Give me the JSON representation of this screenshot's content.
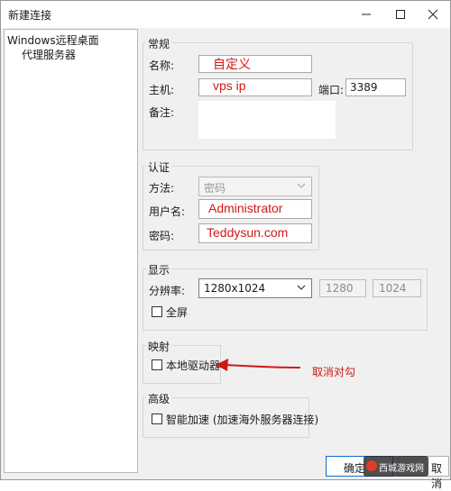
{
  "window": {
    "title": "新建连接",
    "minimize_icon": "minimize-icon",
    "maximize_icon": "maximize-icon",
    "close_icon": "close-icon"
  },
  "tree": {
    "items": [
      {
        "label": "Windows远程桌面",
        "selected": true
      },
      {
        "label": "代理服务器",
        "selected": false
      }
    ]
  },
  "general": {
    "title": "常规",
    "name_label": "名称:",
    "name_value": "自定义",
    "host_label": "主机:",
    "host_value": "vps ip",
    "port_label": "端口:",
    "port_value": "3389",
    "note_label": "备注:",
    "note_value": ""
  },
  "auth": {
    "title": "认证",
    "method_label": "方法:",
    "method_value": "密码",
    "username_label": "用户名:",
    "username_value": "Administrator",
    "password_label": "密码:",
    "password_value": "Teddysun.com"
  },
  "display": {
    "title": "显示",
    "resolution_label": "分辨率:",
    "resolution_value": "1280x1024",
    "width_value": "1280",
    "height_value": "1024",
    "fullscreen_label": "全屏",
    "fullscreen_checked": false
  },
  "mapping": {
    "title": "映射",
    "local_drive_label": "本地驱动器",
    "local_drive_checked": false
  },
  "advanced": {
    "title": "高级",
    "smart_accel_label": "智能加速 (加速海外服务器连接)",
    "smart_accel_checked": false
  },
  "annotation": {
    "text": "取消对勾",
    "color": "#d01818"
  },
  "buttons": {
    "ok_label": "确定",
    "cancel_label": "取消"
  },
  "watermark": {
    "text": "西城游戏网"
  },
  "colors": {
    "accent": "#0b6cd8",
    "annotation_red": "#d01818"
  }
}
